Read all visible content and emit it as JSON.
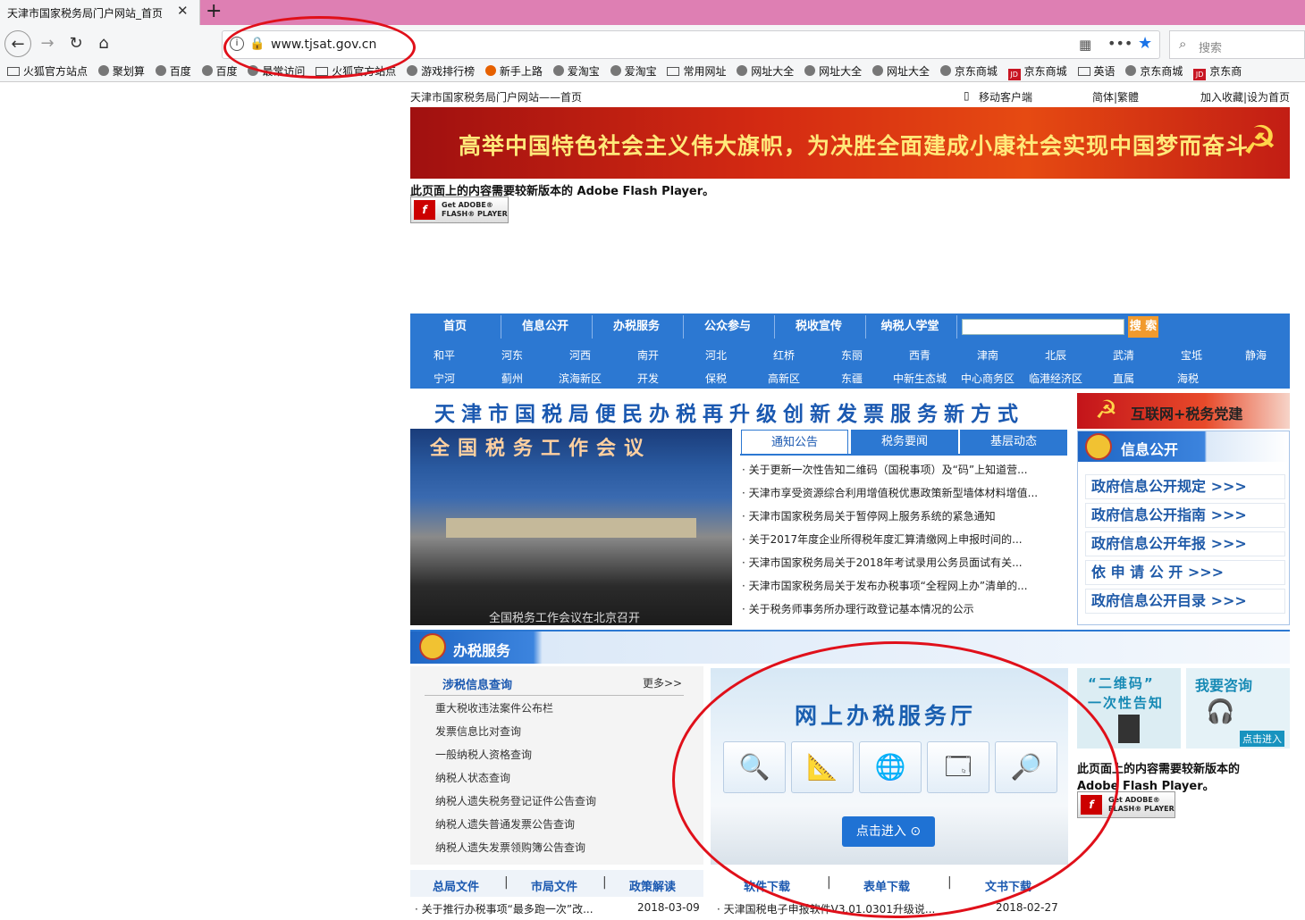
{
  "browser": {
    "tab_title": "天津市国家税务局门户网站_首页",
    "close_symbol": "✕",
    "newtab_symbol": "+",
    "url": "www.tjsat.gov.cn",
    "search_placeholder": "搜索",
    "bookmarks": [
      "火狐官方站点",
      "聚划算",
      "百度",
      "百度",
      "最常访问",
      "火狐官方站点",
      "游戏排行榜",
      "新手上路",
      "爱淘宝",
      "爱淘宝",
      "常用网址",
      "网址大全",
      "网址大全",
      "网址大全",
      "京东商城",
      "京东商城",
      "英语",
      "京东商城",
      "京东商"
    ]
  },
  "site": {
    "breadcrumb": "天津市国家税务局门户网站——首页",
    "mobile_client": "移动客户端",
    "lang_switch": "简体|繁體",
    "favorite": "加入收藏|设为首页",
    "banner_slogan": "高举中国特色社会主义伟大旗帜，为决胜全面建成小康社会实现中国梦而奋斗",
    "flash_message": "此页面上的内容需要较新版本的 Adobe Flash Player。",
    "flash_message_right_1": "此页面上的内容需要较新版本的",
    "flash_message_right_2": "Adobe Flash Player。",
    "flash_btn_line1": "Get ADOBE®",
    "flash_btn_line2": "FLASH® PLAYER",
    "main_nav": [
      "首页",
      "信息公开",
      "办税服务",
      "公众参与",
      "税收宣传",
      "纳税人学堂"
    ],
    "search_button": "搜 索",
    "districts_row1": [
      "和平",
      "河东",
      "河西",
      "南开",
      "河北",
      "红桥",
      "东丽",
      "西青",
      "津南",
      "北辰",
      "武清",
      "宝坻",
      "静海"
    ],
    "districts_row2": [
      "宁河",
      "蓟州",
      "滨海新区",
      "开发",
      "保税",
      "高新区",
      "东疆",
      "中新生态城",
      "中心商务区",
      "临港经济区",
      "直属",
      "海税"
    ],
    "headline": "天津市国税局便民办税再升级创新发票服务新方式",
    "party_banner": "互联网+税务党建",
    "photo_title": "全国税务工作会议",
    "photo_caption": "全国税务工作会议在北京召开",
    "news_tabs": [
      "通知公告",
      "税务要闻",
      "基层动态"
    ],
    "news_items": [
      "关于更新一次性告知二维码（国税事项）及“码”上知道营...",
      "天津市享受资源综合利用增值税优惠政策新型墙体材料增值...",
      "天津市国家税务局关于暂停网上服务系统的紧急通知",
      "关于2017年度企业所得税年度汇算清缴网上申报时间的...",
      "天津市国家税务局关于2018年考试录用公务员面试有关...",
      "天津市国家税务局关于发布办税事项“全程网上办”清单的...",
      "关于税务师事务所办理行政登记基本情况的公示"
    ],
    "info_title": "信息公开",
    "info_links": [
      "政府信息公开规定  >>>",
      "政府信息公开指南  >>>",
      "政府信息公开年报  >>>",
      "依 申 请 公 开    >>>",
      "政府信息公开目录  >>>"
    ],
    "service_title": "办税服务",
    "query_title": "涉税信息查询",
    "query_more": "更多>>",
    "query_items": [
      "重大税收违法案件公布栏",
      "发票信息比对查询",
      "一般纳税人资格查询",
      "纳税人状态查询",
      "纳税人遗失税务登记证件公告查询",
      "纳税人遗失普通发票公告查询",
      "纳税人遗失发票领购簿公告查询"
    ],
    "hall_title": "网上办税服务厅",
    "hall_button": "点击进入 ⊙",
    "qr_line1": "“二维码”",
    "qr_line2": "一次性告知",
    "consult_title": "我要咨询",
    "consult_btn": "点击进入",
    "doc_tabs_left": [
      "总局文件",
      "市局文件",
      "政策解读"
    ],
    "doc_tabs_right": [
      "软件下载",
      "表单下载",
      "文书下载"
    ],
    "doc_item_left": "关于推行办税事项“最多跑一次”改...",
    "doc_date_left": "2018-03-09",
    "doc_item_right": "天津国税电子申报软件V3.01.0301升级说...",
    "doc_date_right": "2018-02-27"
  }
}
